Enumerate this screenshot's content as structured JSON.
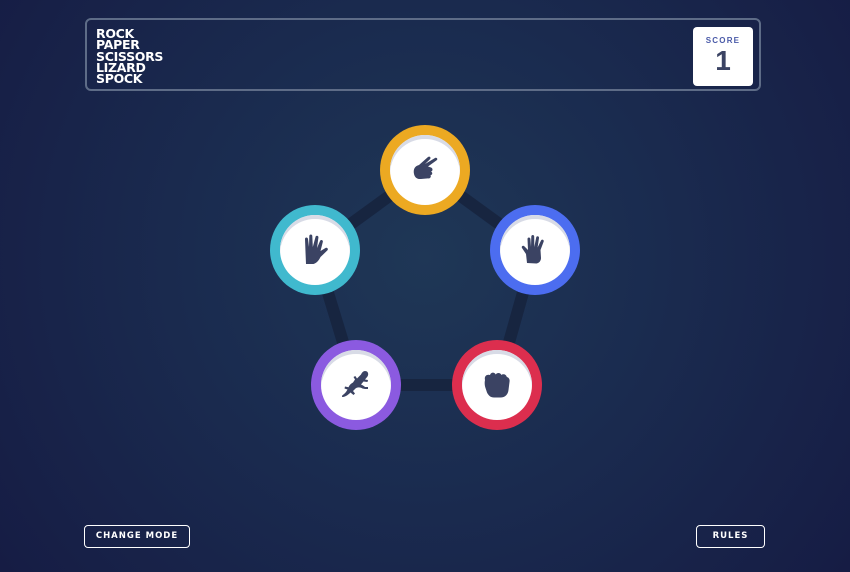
{
  "header": {
    "title_lines": [
      "ROCK",
      "PAPER",
      "SCISSORS",
      "LIZARD",
      "SPOCK"
    ],
    "score_label": "SCORE",
    "score_value": "1"
  },
  "tokens": [
    {
      "name": "scissors",
      "icon": "scissors-hand-icon",
      "color": "#eca922"
    },
    {
      "name": "paper",
      "icon": "paper-hand-icon",
      "color": "#4c6df0"
    },
    {
      "name": "rock",
      "icon": "rock-fist-icon",
      "color": "#dc2e4e"
    },
    {
      "name": "lizard",
      "icon": "lizard-icon",
      "color": "#8b5ae0"
    },
    {
      "name": "spock",
      "icon": "spock-hand-icon",
      "color": "#40b9ce"
    }
  ],
  "buttons": {
    "change_mode": "CHANGE MODE",
    "rules": "RULES"
  },
  "colors": {
    "icon": "#3b4363",
    "pentagon": "#172540"
  }
}
